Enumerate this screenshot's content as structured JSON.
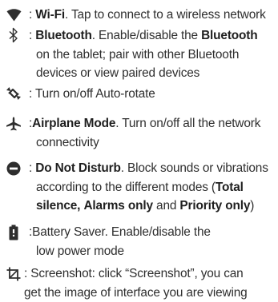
{
  "items": [
    {
      "icon": "wifi-icon",
      "label": "Wi-Fi",
      "description": "Tap to connect to a wireless network"
    },
    {
      "icon": "bluetooth-icon",
      "label": "Bluetooth",
      "desc_part1": "Enable/disable the ",
      "label_inline": "Bluetooth",
      "line2": "on the tablet; pair with other  Bluetooth",
      "line3": "devices or view paired devices"
    },
    {
      "icon": "auto-rotate-icon",
      "description": "Turn on/off Auto-rotate"
    },
    {
      "icon": "airplane-icon",
      "label": "Airplane Mode",
      "line1_rest": "Turn on/off all the network",
      "line2": "connectivity"
    },
    {
      "icon": "do-not-disturb-icon",
      "label": "Do Not Disturb",
      "line1_rest": "Block sounds or vibrations",
      "line2_pre": "according to the different modes (",
      "mode1": "Total",
      "mode1_cont": "silence",
      "mode2": "Alarms only",
      "and_text": "and",
      "mode3": "Priority only",
      "close_paren": ")"
    },
    {
      "icon": "battery-saver-icon",
      "line1": ":Battery Saver. Enable/disable the",
      "line2": "low power mode"
    },
    {
      "icon": "screenshot-icon",
      "line1": ": Screenshot: click “Screenshot”, you can",
      "line2": "get the image of interface you are viewing"
    }
  ]
}
